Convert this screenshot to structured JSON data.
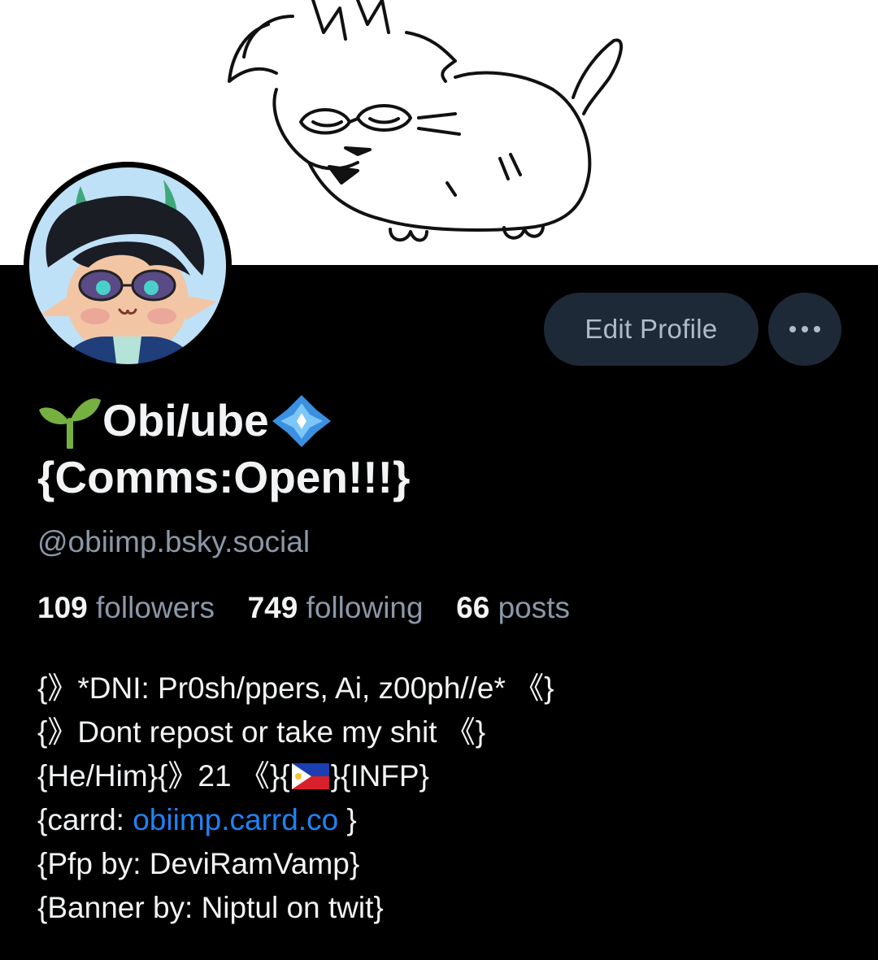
{
  "profile": {
    "display_name_line1": "Obi/ube",
    "display_name_line2": "{Comms:Open!!!}",
    "name_prefix_icon": "seedling-icon",
    "name_suffix_icon": "sparkle-diamond-icon",
    "handle": "@obiimp.bsky.social",
    "edit_button_label": "Edit Profile",
    "more_button_icon": "ellipsis-icon"
  },
  "stats": {
    "followers_count": "109",
    "followers_label": "followers",
    "following_count": "749",
    "following_label": "following",
    "posts_count": "66",
    "posts_label": "posts"
  },
  "bio": {
    "line1": "{》*DNI: Pr0sh/ppers, Ai, z00ph//e* 《}",
    "line2": "{》Dont repost or take my shit 《}",
    "line3_a": "{He/Him}{》21 《}{",
    "line3_flag": "philippines-flag-icon",
    "line3_b": "}{INFP}",
    "line4_prefix": "{carrd: ",
    "line4_link": "obiimp.carrd.co",
    "line4_suffix": " }",
    "line5": "{Pfp by: DeviRamVamp}",
    "line6": "{Banner by: Niptul on twit}"
  },
  "colors": {
    "background": "#000000",
    "button_bg": "#1e2937",
    "secondary_text": "#8b98a8",
    "link": "#1d83f5"
  }
}
